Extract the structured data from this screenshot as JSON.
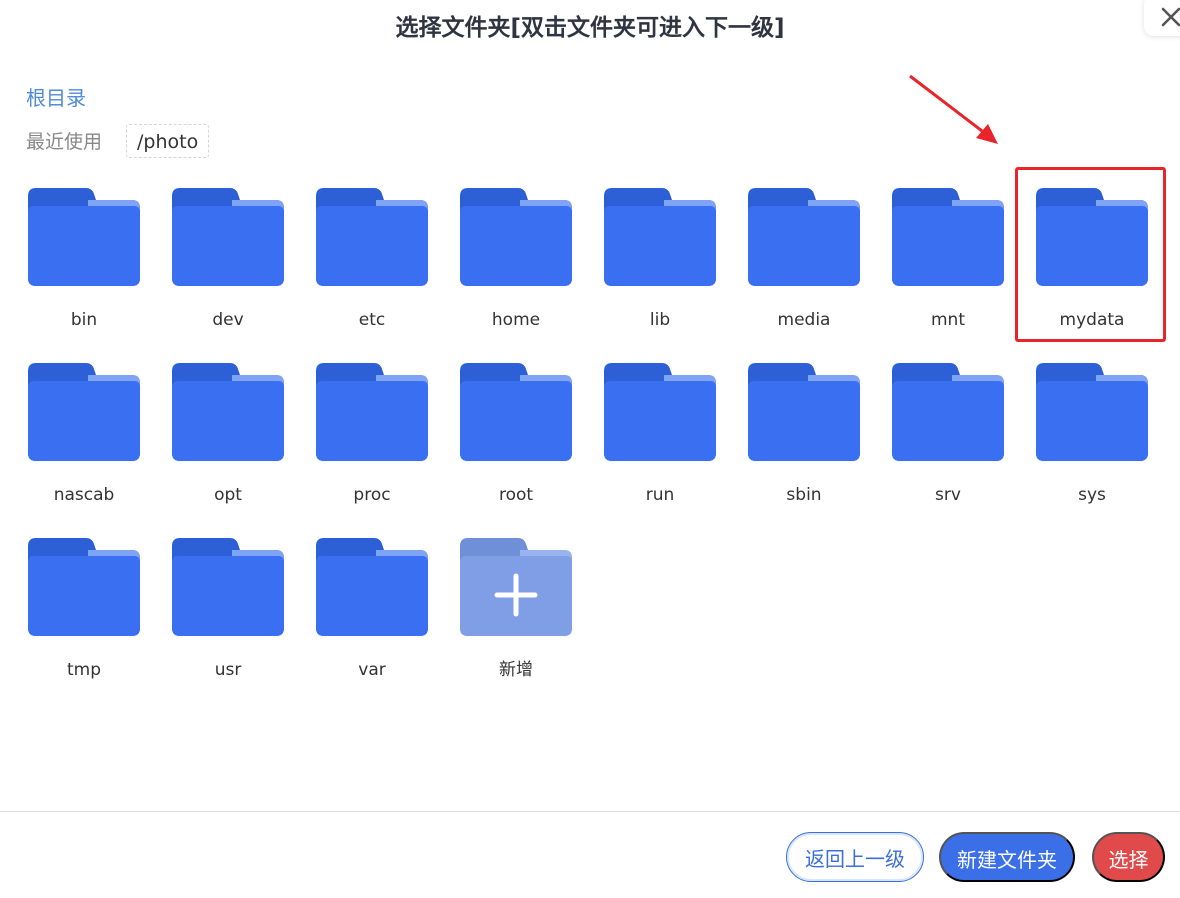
{
  "dialog": {
    "title": "选择文件夹[双击文件夹可进入下一级]"
  },
  "nav": {
    "root_label": "根目录",
    "recent_label": "最近使用",
    "recent_paths": [
      "/photo"
    ]
  },
  "folders": [
    {
      "label": "bin"
    },
    {
      "label": "dev"
    },
    {
      "label": "etc"
    },
    {
      "label": "home"
    },
    {
      "label": "lib"
    },
    {
      "label": "media"
    },
    {
      "label": "mnt"
    },
    {
      "label": "mydata"
    },
    {
      "label": "nascab"
    },
    {
      "label": "opt"
    },
    {
      "label": "proc"
    },
    {
      "label": "root"
    },
    {
      "label": "run"
    },
    {
      "label": "sbin"
    },
    {
      "label": "srv"
    },
    {
      "label": "sys"
    },
    {
      "label": "tmp"
    },
    {
      "label": "usr"
    },
    {
      "label": "var"
    }
  ],
  "add_tile": {
    "label": "新增"
  },
  "footer": {
    "back_label": "返回上一级",
    "new_folder_label": "新建文件夹",
    "select_label": "选择"
  },
  "colors": {
    "folder_front": "#3b6ff2",
    "folder_back": "#2d5fd6",
    "folder_back_light": "#7fa3f5",
    "add_folder": "#7f9ee6",
    "highlight": "#e8252b"
  }
}
